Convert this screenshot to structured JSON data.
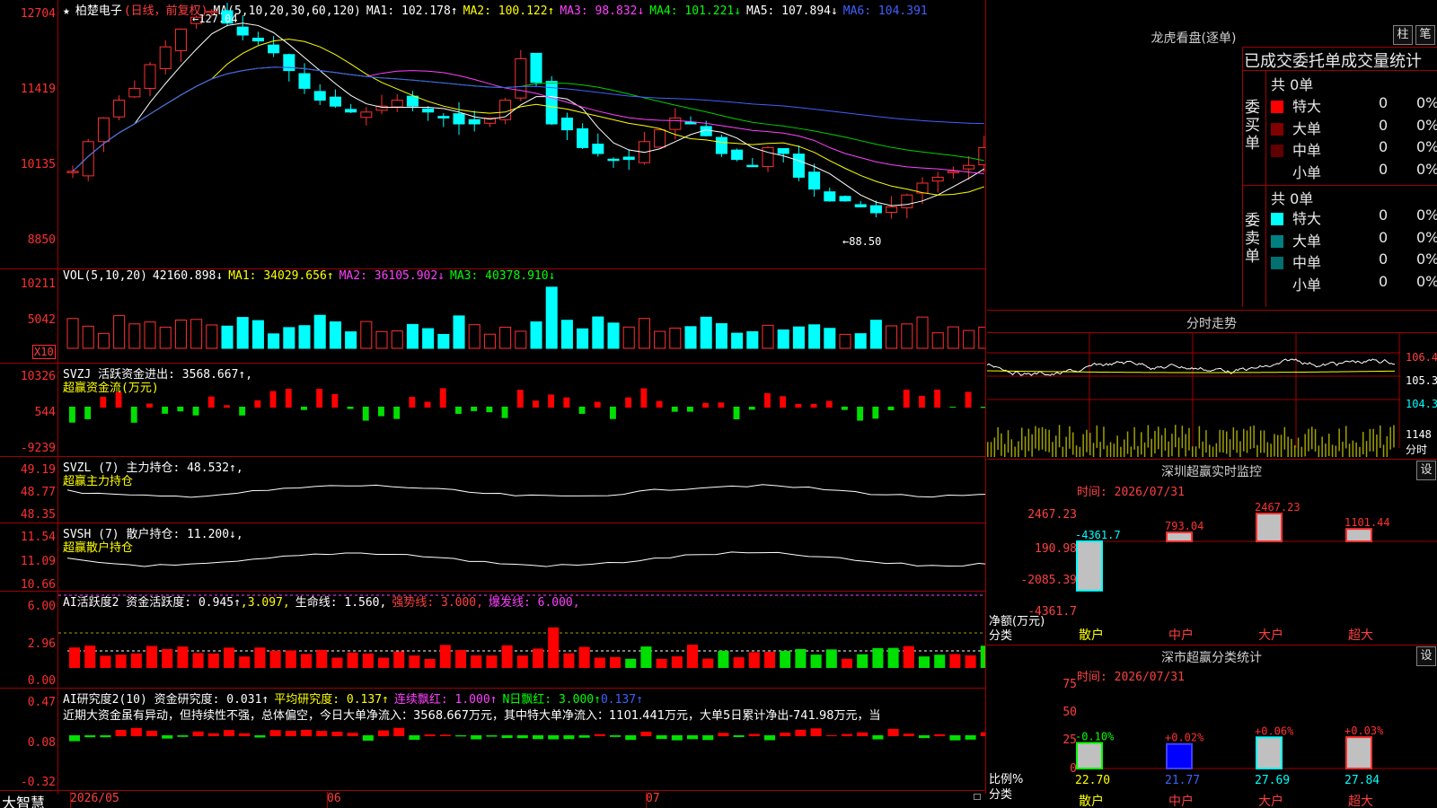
{
  "main": {
    "title_star": "★",
    "stock_name": "柏楚电子",
    "period": "(日线，前复权)",
    "ma_label": "MA(5,10,20,30,60,120)",
    "ma1": "MA1: 102.178↑",
    "ma2": "MA2: 100.122↑",
    "ma3": "MA3: 98.832↓",
    "ma4": "MA4: 101.221↓",
    "ma5": "MA5: 107.894↓",
    "ma6": "MA6: 104.391",
    "high_mark": "←127.04",
    "low_mark": "←88.50",
    "y_ticks": [
      "12704",
      "11419",
      "10135",
      "8850"
    ]
  },
  "volume": {
    "label": "VOL(5,10,20)",
    "value": "42160.898↓",
    "ma1": "MA1: 34029.656↑",
    "ma2": "MA2: 36105.902↓",
    "ma3": "MA3: 40378.910↓",
    "y_ticks": [
      "10211",
      "5042"
    ],
    "unit": "X10"
  },
  "svzj": {
    "label": "SVZJ  活跃资金进出: 3568.667↑,",
    "sub": "超赢资金流(万元)",
    "y_ticks": [
      "10326",
      "544",
      "-9239"
    ]
  },
  "svzl": {
    "label": "SVZL (7) 主力持仓: 48.532↑,",
    "sub": "超赢主力持仓",
    "y_ticks": [
      "49.19",
      "48.77",
      "48.35"
    ]
  },
  "svsh": {
    "label": "SVSH (7) 散户持仓: 11.200↓,",
    "sub": "超赢散户持仓",
    "y_ticks": [
      "11.54",
      "11.09",
      "10.66"
    ]
  },
  "ai1": {
    "label": "AI活跃度2 资金活跃度: 0.945↑",
    "v2": ",3.097,",
    "life": "生命线: 1.560,",
    "strong": "强势线: 3.000,",
    "burst": "爆发线: 6.000,",
    "y_ticks": [
      "6.00",
      "2.96",
      "0.00"
    ]
  },
  "ai2": {
    "label": "AI研究度2(10) 资金研究度: 0.031↑",
    "avg": "平均研究度: 0.137↑",
    "red": "连续飘红: 1.000↑",
    "nred": "N日飘红: 3.000↑",
    "last": "0.137↑",
    "y_ticks": [
      "0.47",
      "0.08",
      "-0.32"
    ],
    "comment": "近期大资金虽有异动，但持续性不强，总体偏空，今日大单净流入：3568.667万元，其中特大单净流入：1101.441万元，大单5日累计净出-741.98万元，当"
  },
  "bottom": {
    "brand": "大智慧",
    "dates": [
      "2026/05",
      "06",
      "07"
    ]
  },
  "right": {
    "lhb_title": "龙虎看盘(逐单)",
    "btn_zhu": "柱",
    "btn_bi": "笔",
    "stats_title": "已成交委托单成交量统计",
    "buy_label": "委买单",
    "sell_label": "委卖单",
    "buy_total": "共 0单",
    "sell_total": "共 0单",
    "buy_rows": [
      {
        "name": "特大",
        "count": "0",
        "pct": "0%",
        "color": "#ff0000"
      },
      {
        "name": "大单",
        "count": "0",
        "pct": "0%",
        "color": "#800000"
      },
      {
        "name": "中单",
        "count": "0",
        "pct": "0%",
        "color": "#600000"
      },
      {
        "name": "小单",
        "count": "0",
        "pct": "0%",
        "color": "#000000"
      }
    ],
    "sell_rows": [
      {
        "name": "特大",
        "count": "0",
        "pct": "0%",
        "color": "#00ffff"
      },
      {
        "name": "大单",
        "count": "0",
        "pct": "0%",
        "color": "#008080"
      },
      {
        "name": "中单",
        "count": "0",
        "pct": "0%",
        "color": "#007070"
      },
      {
        "name": "小单",
        "count": "0",
        "pct": "0%",
        "color": "#000000"
      }
    ],
    "intraday_title": "分时走势",
    "intraday_ticks": [
      "106.4",
      "105.3",
      "104.3",
      "1148"
    ],
    "intraday_unit": "分时",
    "sz_title": "深圳超赢实时监控",
    "sz_btn": "设",
    "sz_time": "时间: 2026/07/31",
    "sz_ticks": [
      "2467.23",
      "190.98",
      "-2085.39",
      "-4361.7"
    ],
    "sz_ylabel": "净额(万元)",
    "sz_xlabel": "分类",
    "sz_values": [
      "-4361.7",
      "793.04",
      "2467.23",
      "1101.44"
    ],
    "sz_cats": [
      "散户",
      "中户",
      "大户",
      "超大"
    ],
    "cls_title": "深市超赢分类统计",
    "cls_btn": "设",
    "cls_time": "时间: 2026/07/31",
    "cls_ticks": [
      "75",
      "50",
      "25",
      "0"
    ],
    "cls_ylabel": "比例%",
    "cls_xlabel": "分类",
    "cls_changes": [
      "-0.10%",
      "+0.02%",
      "+0.06%",
      "+0.03%"
    ],
    "cls_values": [
      "22.70",
      "21.77",
      "27.69",
      "27.84"
    ],
    "cls_cats": [
      "散户",
      "中户",
      "大户",
      "超大"
    ]
  },
  "colors": {
    "up": "#ff3030",
    "down": "#00ffff",
    "grid": "#a00000",
    "fund_up": "#ff0000",
    "fund_down": "#00e000"
  }
}
